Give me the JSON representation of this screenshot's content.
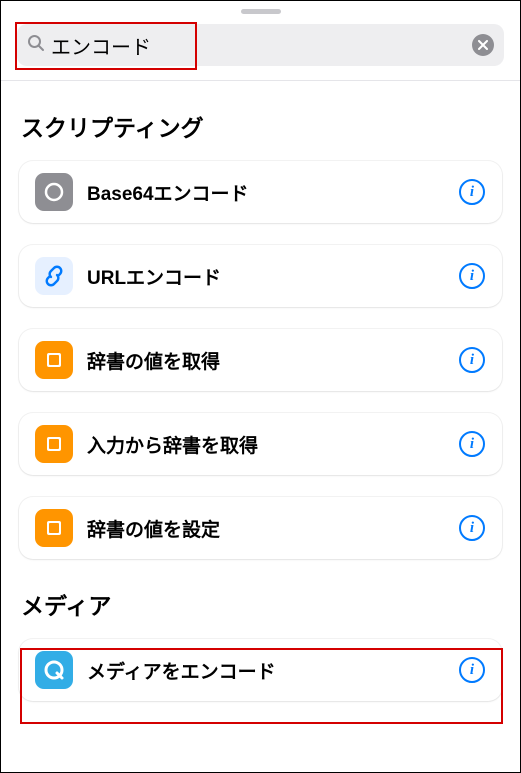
{
  "search": {
    "query": "エンコード",
    "placeholder": ""
  },
  "sections": [
    {
      "title": "スクリプティング",
      "items": [
        {
          "id": "base64-encode",
          "label": "Base64エンコード",
          "icon": "circle-gray"
        },
        {
          "id": "url-encode",
          "label": "URLエンコード",
          "icon": "link-blue"
        },
        {
          "id": "get-dictionary-value",
          "label": "辞書の値を取得",
          "icon": "doc-orange"
        },
        {
          "id": "get-dictionary-from-input",
          "label": "入力から辞書を取得",
          "icon": "doc-orange"
        },
        {
          "id": "set-dictionary-value",
          "label": "辞書の値を設定",
          "icon": "doc-orange"
        }
      ]
    },
    {
      "title": "メディア",
      "items": [
        {
          "id": "encode-media",
          "label": "メディアをエンコード",
          "icon": "quicktime-cyan"
        }
      ]
    }
  ],
  "colors": {
    "accent": "#007aff",
    "orange": "#ff9500",
    "cyan": "#32ade6",
    "gray": "#8e8e93",
    "highlight": "#d40000"
  }
}
